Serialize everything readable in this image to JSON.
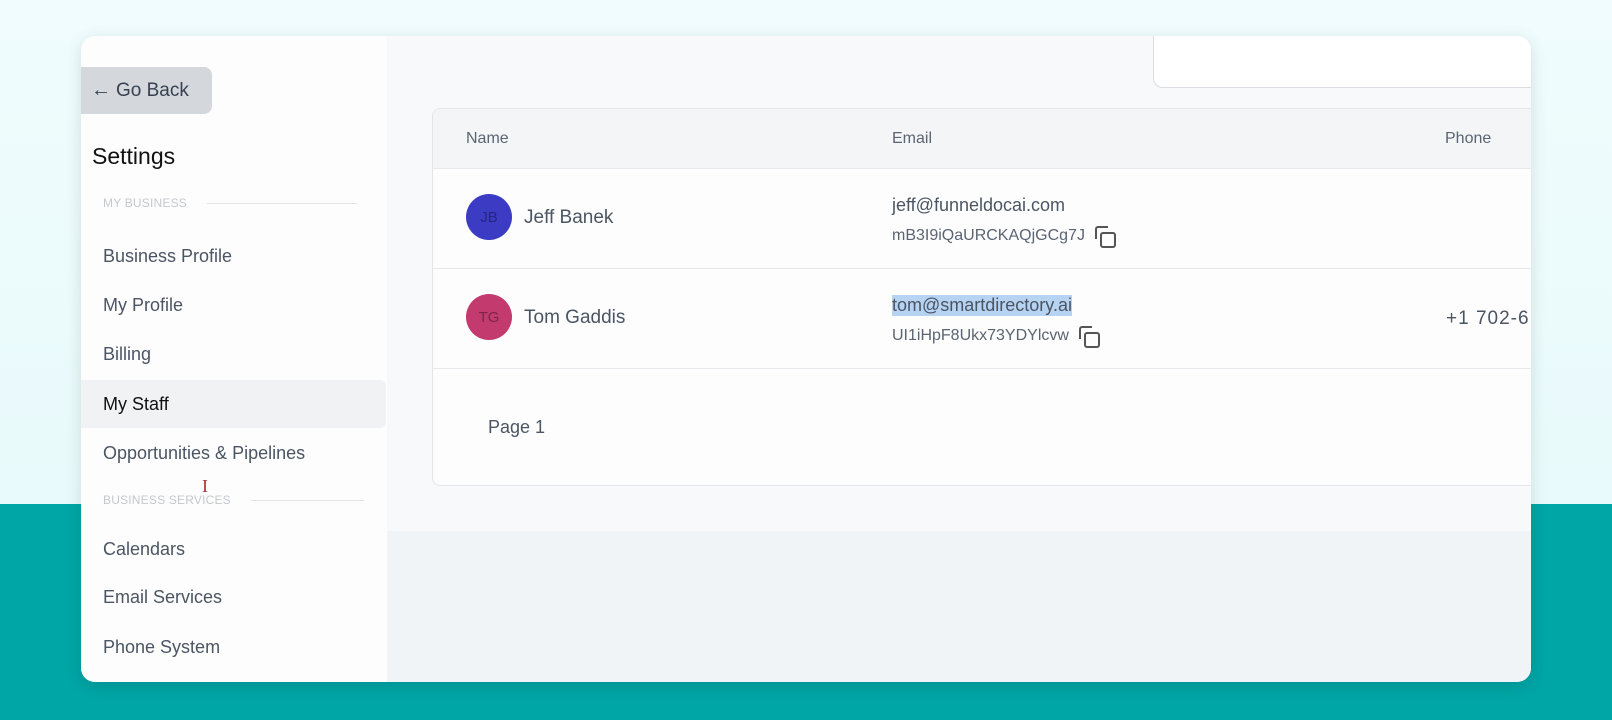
{
  "sidebar": {
    "go_back": "Go Back",
    "title": "Settings",
    "section_my_business": "MY BUSINESS",
    "section_business_services": "BUSINESS SERVICES",
    "items": [
      {
        "label": "Business Profile"
      },
      {
        "label": "My Profile"
      },
      {
        "label": "Billing"
      },
      {
        "label": "My Staff",
        "active": true
      },
      {
        "label": "Opportunities & Pipelines"
      },
      {
        "label": "Calendars"
      },
      {
        "label": "Email Services"
      },
      {
        "label": "Phone System"
      }
    ]
  },
  "table": {
    "headers": {
      "name": "Name",
      "email": "Email",
      "phone": "Phone"
    },
    "rows": [
      {
        "initials": "JB",
        "name": "Jeff Banek",
        "email": "jeff@funneldocai.com",
        "id": "mB3I9iQaURCKAQjGCg7J",
        "phone": "",
        "avatar_color": "#3b3bc4"
      },
      {
        "initials": "TG",
        "name": "Tom Gaddis",
        "email": "tom@smartdirectory.ai",
        "id": "UI1iHpF8Ukx73YDYlcvw",
        "phone": "+1 702-6",
        "avatar_color": "#c23a6e",
        "email_selected": true
      }
    ],
    "pagination": "Page 1"
  }
}
